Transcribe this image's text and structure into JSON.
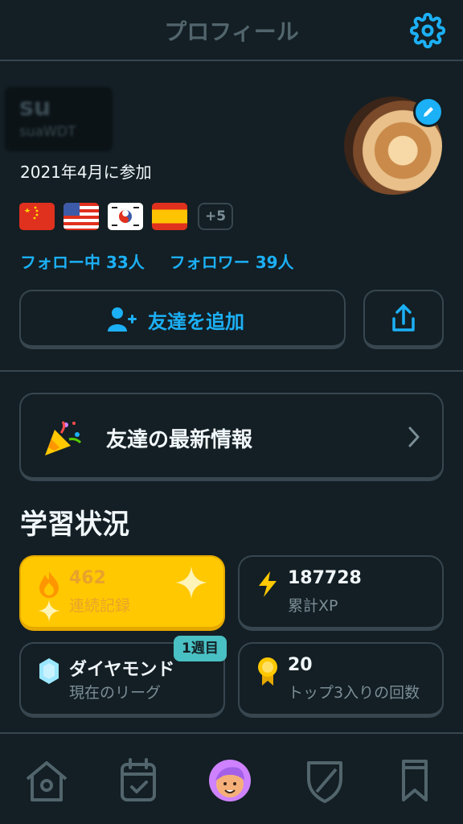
{
  "header": {
    "title": "プロフィール"
  },
  "profile": {
    "name": "su",
    "username": "suaWDT",
    "joined": "2021年4月に参加",
    "flags": [
      "china-flag",
      "usa-flag",
      "korea-flag",
      "spain-flag"
    ],
    "more_flags": "+5",
    "following": "フォロー中 33人",
    "followers": "フォロワー 39人"
  },
  "actions": {
    "add_friend": "友達を追加"
  },
  "news": {
    "label": "友達の最新情報"
  },
  "stats": {
    "title": "学習状況",
    "streak": {
      "value": "462",
      "label": "連続記録"
    },
    "xp": {
      "value": "187728",
      "label": "累計XP"
    },
    "league": {
      "value": "ダイヤモンド",
      "label": "現在のリーグ",
      "badge": "1週目"
    },
    "top3": {
      "value": "20",
      "label": "トップ3入りの回数"
    }
  },
  "colors": {
    "accent": "#1cb0f6",
    "background": "#131f24",
    "border": "#37464f",
    "streak": "#ffc800"
  },
  "nav": [
    "home-icon",
    "calendar-icon",
    "profile-avatar-icon",
    "shield-icon",
    "bookmark-icon"
  ]
}
